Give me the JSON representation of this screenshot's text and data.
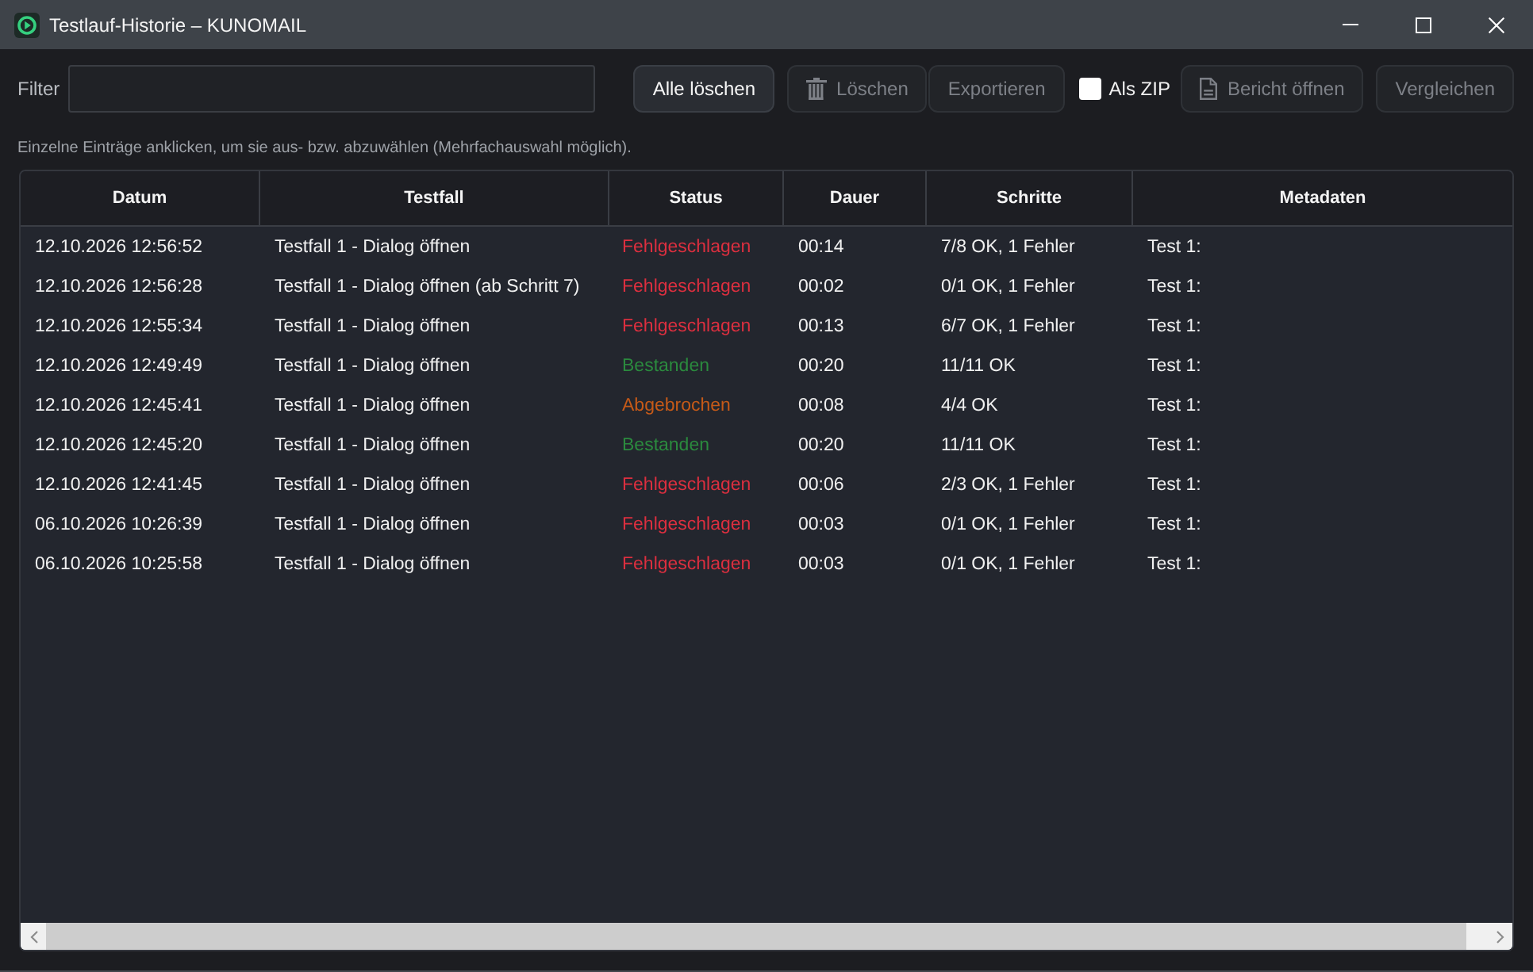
{
  "window": {
    "title": "Testlauf-Historie – KUNOMAIL"
  },
  "toolbar": {
    "filter_label": "Filter",
    "items": [
      {
        "kind": "button",
        "label": "Alle löschen",
        "disabled": false
      },
      {
        "kind": "button",
        "label": "Löschen",
        "disabled": true
      },
      {
        "kind": "button",
        "label": "Exportieren",
        "disabled": true
      },
      {
        "kind": "checkbox",
        "label": "Als ZIP",
        "checked": false
      },
      {
        "kind": "button",
        "label": "Bericht öffnen",
        "disabled": true
      },
      {
        "kind": "button",
        "label": "Vergleichen",
        "disabled": true
      }
    ]
  },
  "hint": "Einzelne Einträge anklicken, um sie aus- bzw. abzuwählen (Mehrfachauswahl möglich).",
  "table": {
    "columns": [
      "Datum",
      "Testfall",
      "Status",
      "Dauer",
      "Schritte",
      "Metadaten"
    ],
    "rows": [
      {
        "selected": false,
        "datum": "12.10.2026 12:56:52",
        "testfall": "Testfall 1 - Dialog öffnen",
        "status": {
          "text": "Fehlgeschlagen",
          "color": "#dc2f3f"
        },
        "dauer": "00:14",
        "schritte": "7/8 OK, 1 Fehler",
        "metadaten": "Test 1:"
      },
      {
        "selected": false,
        "datum": "12.10.2026 12:56:28",
        "testfall": "Testfall 1 - Dialog öffnen (ab Schritt 7)",
        "status": {
          "text": "Fehlgeschlagen",
          "color": "#dc2f3f"
        },
        "dauer": "00:02",
        "schritte": "0/1 OK, 1 Fehler",
        "metadaten": "Test 1:"
      },
      {
        "selected": false,
        "datum": "12.10.2026 12:55:34",
        "testfall": "Testfall 1 - Dialog öffnen",
        "status": {
          "text": "Fehlgeschlagen",
          "color": "#dc2f3f"
        },
        "dauer": "00:13",
        "schritte": "6/7 OK, 1 Fehler",
        "metadaten": "Test 1:"
      },
      {
        "selected": false,
        "datum": "12.10.2026 12:49:49",
        "testfall": "Testfall 1 - Dialog öffnen",
        "status": {
          "text": "Bestanden",
          "color": "#2b8a3e"
        },
        "dauer": "00:20",
        "schritte": "11/11 OK",
        "metadaten": "Test 1:"
      },
      {
        "selected": false,
        "datum": "12.10.2026 12:45:41",
        "testfall": "Testfall 1 - Dialog öffnen",
        "status": {
          "text": "Abgebrochen",
          "color": "#c65a18"
        },
        "dauer": "00:08",
        "schritte": "4/4 OK",
        "metadaten": "Test 1:"
      },
      {
        "selected": false,
        "datum": "12.10.2026 12:45:20",
        "testfall": "Testfall 1 - Dialog öffnen",
        "status": {
          "text": "Bestanden",
          "color": "#2b8a3e"
        },
        "dauer": "00:20",
        "schritte": "11/11 OK",
        "metadaten": "Test 1:"
      },
      {
        "selected": false,
        "datum": "12.10.2026 12:41:45",
        "testfall": "Testfall 1 - Dialog öffnen",
        "status": {
          "text": "Fehlgeschlagen",
          "color": "#dc2f3f"
        },
        "dauer": "00:06",
        "schritte": "2/3 OK, 1 Fehler",
        "metadaten": "Test 1:"
      },
      {
        "selected": false,
        "datum": "06.10.2026 10:26:39",
        "testfall": "Testfall 1 - Dialog öffnen",
        "status": {
          "text": "Fehlgeschlagen",
          "color": "#dc2f3f"
        },
        "dauer": "00:03",
        "schritte": "0/1 OK, 1 Fehler",
        "metadaten": "Test 1:"
      },
      {
        "selected": false,
        "datum": "06.10.2026 10:25:58",
        "testfall": "Testfall 1 - Dialog öffnen",
        "status": {
          "text": "Fehlgeschlagen",
          "color": "#dc2f3f"
        },
        "dauer": "00:03",
        "schritte": "0/1 OK, 1 Fehler",
        "metadaten": "Test 1:"
      }
    ]
  }
}
